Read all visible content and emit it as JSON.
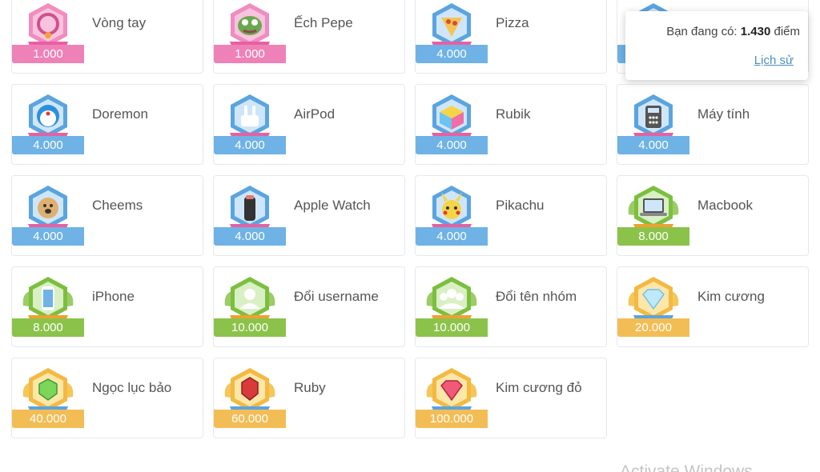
{
  "items": [
    {
      "name": "Vòng tay",
      "price": "1.000",
      "tier": "pink",
      "icon": "bracelet-icon"
    },
    {
      "name": "Ếch Pepe",
      "price": "1.000",
      "tier": "pink",
      "icon": "pepe-frog-icon"
    },
    {
      "name": "Pizza",
      "price": "4.000",
      "tier": "blue",
      "icon": "pizza-icon"
    },
    {
      "name": "",
      "price": "",
      "tier": "blue",
      "icon": "hidden-item-icon"
    },
    {
      "name": "Doremon",
      "price": "4.000",
      "tier": "blue",
      "icon": "doraemon-icon"
    },
    {
      "name": "AirPod",
      "price": "4.000",
      "tier": "blue",
      "icon": "airpods-icon"
    },
    {
      "name": "Rubik",
      "price": "4.000",
      "tier": "blue",
      "icon": "rubik-cube-icon"
    },
    {
      "name": "Máy tính",
      "price": "4.000",
      "tier": "blue",
      "icon": "calculator-icon"
    },
    {
      "name": "Cheems",
      "price": "4.000",
      "tier": "blue",
      "icon": "cheems-dog-icon"
    },
    {
      "name": "Apple Watch",
      "price": "4.000",
      "tier": "blue",
      "icon": "apple-watch-icon"
    },
    {
      "name": "Pikachu",
      "price": "4.000",
      "tier": "blue",
      "icon": "pikachu-icon"
    },
    {
      "name": "Macbook",
      "price": "8.000",
      "tier": "green",
      "icon": "laptop-icon"
    },
    {
      "name": "iPhone",
      "price": "8.000",
      "tier": "green",
      "icon": "phone-icon"
    },
    {
      "name": "Đổi username",
      "price": "10.000",
      "tier": "green",
      "icon": "user-icon"
    },
    {
      "name": "Đổi tên nhóm",
      "price": "10.000",
      "tier": "green",
      "icon": "group-icon"
    },
    {
      "name": "Kim cương",
      "price": "20.000",
      "tier": "gold",
      "icon": "diamond-icon"
    },
    {
      "name": "Ngọc lục bảo",
      "price": "40.000",
      "tier": "gold",
      "icon": "emerald-icon"
    },
    {
      "name": "Ruby",
      "price": "60.000",
      "tier": "gold",
      "icon": "ruby-icon"
    },
    {
      "name": "Kim cương đỏ",
      "price": "100.000",
      "tier": "gold",
      "icon": "red-diamond-icon"
    }
  ],
  "popup": {
    "points_label": "Bạn đang có:",
    "points_value": "1.430",
    "points_unit": "điểm",
    "history_link": "Lịch sử"
  },
  "watermark": "Activate Windows",
  "colors": {
    "pink": "#ee82b8",
    "blue": "#6eb2e6",
    "green": "#8bc34a",
    "gold": "#f3bd55",
    "link": "#4a90c2"
  }
}
